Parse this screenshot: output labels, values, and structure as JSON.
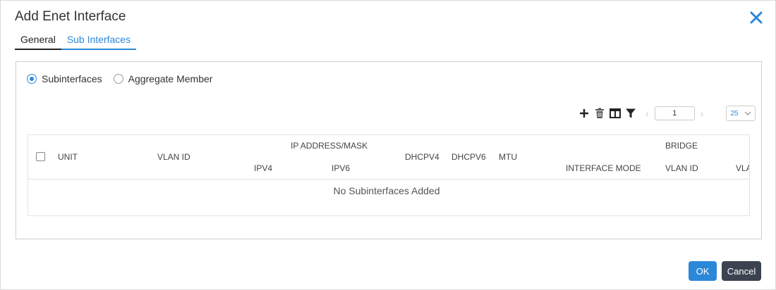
{
  "dialog": {
    "title": "Add Enet Interface"
  },
  "tabs": [
    {
      "label": "General"
    },
    {
      "label": "Sub Interfaces"
    }
  ],
  "radio_options": [
    {
      "label": "Subinterfaces",
      "selected": true
    },
    {
      "label": "Aggregate Member",
      "selected": false
    }
  ],
  "toolbar": {
    "page": "1",
    "page_size": "25"
  },
  "table": {
    "headers": {
      "unit": "UNIT",
      "vlan_id": "VLAN ID",
      "ip_group": "IP ADDRESS/MASK",
      "ipv4": "IPV4",
      "ipv6": "IPV6",
      "dhcpv4": "DHCPV4",
      "dhcpv6": "DHCPV6",
      "mtu": "MTU",
      "interface_mode": "INTERFACE MODE",
      "bridge_group": "BRIDGE",
      "bridge_vlan_id": "VLAN ID",
      "vla_truncated": "VLA"
    },
    "empty_message": "No Subinterfaces Added"
  },
  "buttons": {
    "ok": "OK",
    "cancel": "Cancel"
  },
  "colors": {
    "accent": "#2b88d8",
    "cancel_bg": "#3c4350"
  }
}
